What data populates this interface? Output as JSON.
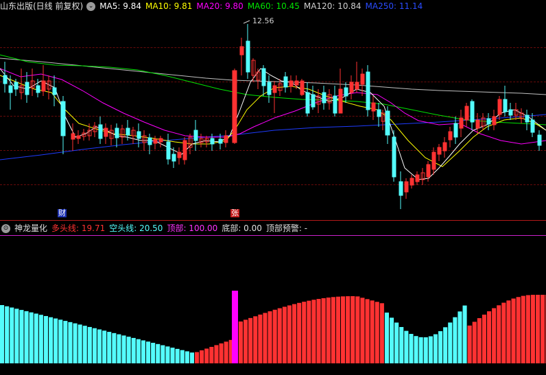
{
  "top_bar": {
    "title": "山东出版(日线 前复权)",
    "ma5": "MA5: 9.84",
    "ma10": "MA10: 9.81",
    "ma20": "MA20: 9.80",
    "ma60": "MA60: 10.45",
    "ma120": "MA120: 10.84",
    "ma250": "MA250: 11.14"
  },
  "indicator_bar": {
    "name": "神龙量化",
    "long_line": "多头线: 19.71",
    "short_line": "空头线: 20.50",
    "top": "顶部: 100.00",
    "bottom": "底部: 0.00",
    "top_warning": "顶部预警: -"
  },
  "annotations": {
    "high_label": "12.56",
    "event_cai": "财",
    "event_zhang": "张"
  },
  "colors": {
    "up": "#ff3232",
    "down": "#54fcfc",
    "ma5": "#ffffff",
    "ma10": "#ffff00",
    "ma20": "#ff00ff",
    "ma60": "#00e600",
    "ma120": "#c0c0c0",
    "ma250": "#1e3cff",
    "signal": "#ff00ff"
  }
}
